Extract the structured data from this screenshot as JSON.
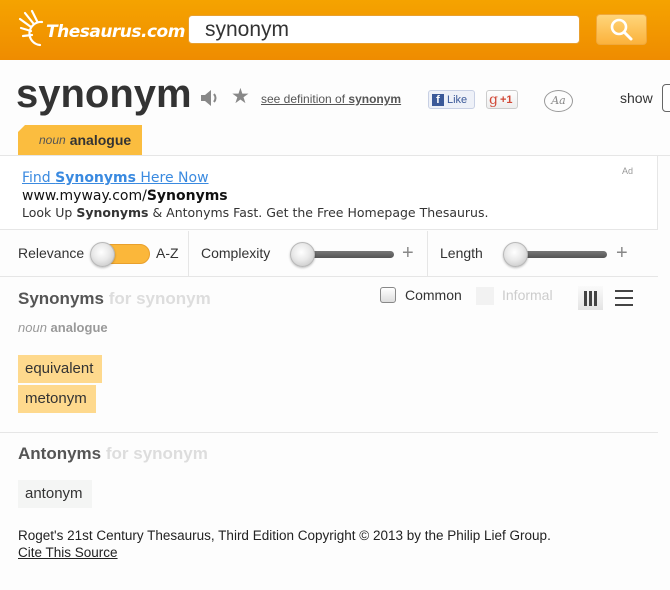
{
  "header": {
    "logo_text": "Thesaurus.com",
    "search_value": "synonym",
    "search_button_icon": "magnifier-icon",
    "brand_color": "#f29a00"
  },
  "entry": {
    "word": "synonym",
    "speaker_icon": "speaker-icon",
    "star_icon": "star-icon",
    "see_definition_prefix": "see definition of ",
    "see_definition_word": "synonym",
    "fb_like_label": "Like",
    "gplus_label": "+1",
    "font_size_label": "Aa",
    "show_label": "show",
    "sense_tab": {
      "pos": "noun",
      "sense": "analogue"
    }
  },
  "ad": {
    "title_pre": "Find ",
    "title_bold": "Synonyms",
    "title_post": " Here Now",
    "url_pre": "www.myway.com/",
    "url_bold": "Synonyms",
    "desc_pre": "Look Up ",
    "desc_bold": "Synonyms",
    "desc_post": " & Antonyms Fast. Get the Free Homepage Thesaurus.",
    "label": "Ad"
  },
  "filters": {
    "relevance_label": "Relevance",
    "az_label": "A-Z",
    "sort_toggle_value": "Relevance",
    "complexity_label": "Complexity",
    "complexity_value": 0,
    "length_label": "Length",
    "length_value": 0,
    "plus": "+"
  },
  "synonyms": {
    "title": "Synonyms",
    "for_text": "for synonym",
    "common_label": "Common",
    "common_checked": false,
    "informal_label": "Informal",
    "sense": {
      "pos": "noun",
      "sense": "analogue"
    },
    "items": [
      "equivalent",
      "metonym"
    ],
    "chip_color": "#fed98d"
  },
  "antonyms": {
    "title": "Antonyms",
    "for_text": "for synonym",
    "items": [
      "antonym"
    ]
  },
  "footer": {
    "copyright": "Roget's 21st Century Thesaurus, Third Edition Copyright © 2013 by the Philip Lief Group.",
    "cite_label": "Cite This Source"
  }
}
